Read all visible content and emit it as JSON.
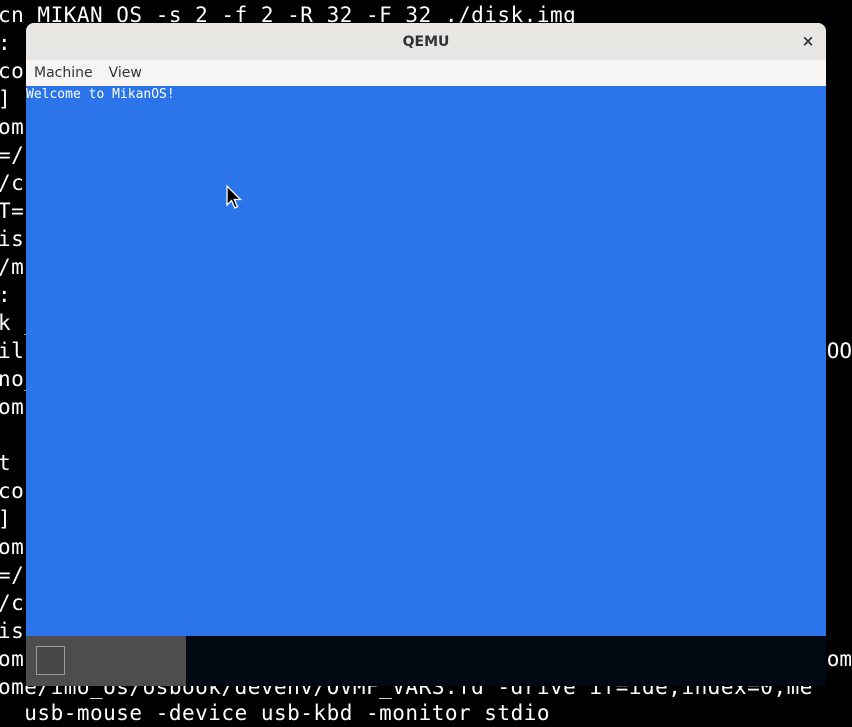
{
  "terminal": {
    "lines": [
      "cn MIKAN OS -s 2 -f 2 -R 32 -F 32 ./disk.img",
      ": (",
      "cos",
      "] ",
      "om",
      "=/",
      "/c",
      "T=",
      "is",
      "/m",
      ": -",
      "k _",
      "il",
      "no_",
      "om",
      "",
      "t ",
      "cos",
      "] ",
      "om",
      "=/",
      "/c",
      "is",
      "om-",
      "ome/imo_os/osbook/devenv/OVMF_VARS.fd -drive if=ide,index=0,me",
      "  usb-mouse -device usb-kbd -monitor stdio"
    ],
    "right_fragments": [
      "OO",
      "om"
    ]
  },
  "window": {
    "title": "QEMU",
    "close_label": "×",
    "menu": [
      "Machine",
      "View"
    ]
  },
  "guest": {
    "text": "Welcome to MikanOS!",
    "background": "#2b74ea"
  },
  "icons": {
    "close": "close-icon",
    "cursor": "mouse-pointer-icon"
  }
}
